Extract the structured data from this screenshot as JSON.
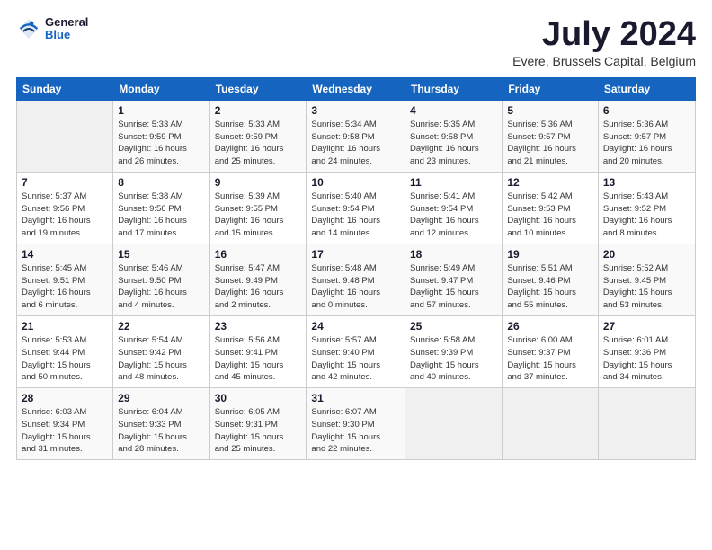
{
  "logo": {
    "general": "General",
    "blue": "Blue"
  },
  "header": {
    "month": "July 2024",
    "location": "Evere, Brussels Capital, Belgium"
  },
  "weekdays": [
    "Sunday",
    "Monday",
    "Tuesday",
    "Wednesday",
    "Thursday",
    "Friday",
    "Saturday"
  ],
  "weeks": [
    [
      {
        "day": "",
        "info": ""
      },
      {
        "day": "1",
        "info": "Sunrise: 5:33 AM\nSunset: 9:59 PM\nDaylight: 16 hours\nand 26 minutes."
      },
      {
        "day": "2",
        "info": "Sunrise: 5:33 AM\nSunset: 9:59 PM\nDaylight: 16 hours\nand 25 minutes."
      },
      {
        "day": "3",
        "info": "Sunrise: 5:34 AM\nSunset: 9:58 PM\nDaylight: 16 hours\nand 24 minutes."
      },
      {
        "day": "4",
        "info": "Sunrise: 5:35 AM\nSunset: 9:58 PM\nDaylight: 16 hours\nand 23 minutes."
      },
      {
        "day": "5",
        "info": "Sunrise: 5:36 AM\nSunset: 9:57 PM\nDaylight: 16 hours\nand 21 minutes."
      },
      {
        "day": "6",
        "info": "Sunrise: 5:36 AM\nSunset: 9:57 PM\nDaylight: 16 hours\nand 20 minutes."
      }
    ],
    [
      {
        "day": "7",
        "info": "Sunrise: 5:37 AM\nSunset: 9:56 PM\nDaylight: 16 hours\nand 19 minutes."
      },
      {
        "day": "8",
        "info": "Sunrise: 5:38 AM\nSunset: 9:56 PM\nDaylight: 16 hours\nand 17 minutes."
      },
      {
        "day": "9",
        "info": "Sunrise: 5:39 AM\nSunset: 9:55 PM\nDaylight: 16 hours\nand 15 minutes."
      },
      {
        "day": "10",
        "info": "Sunrise: 5:40 AM\nSunset: 9:54 PM\nDaylight: 16 hours\nand 14 minutes."
      },
      {
        "day": "11",
        "info": "Sunrise: 5:41 AM\nSunset: 9:54 PM\nDaylight: 16 hours\nand 12 minutes."
      },
      {
        "day": "12",
        "info": "Sunrise: 5:42 AM\nSunset: 9:53 PM\nDaylight: 16 hours\nand 10 minutes."
      },
      {
        "day": "13",
        "info": "Sunrise: 5:43 AM\nSunset: 9:52 PM\nDaylight: 16 hours\nand 8 minutes."
      }
    ],
    [
      {
        "day": "14",
        "info": "Sunrise: 5:45 AM\nSunset: 9:51 PM\nDaylight: 16 hours\nand 6 minutes."
      },
      {
        "day": "15",
        "info": "Sunrise: 5:46 AM\nSunset: 9:50 PM\nDaylight: 16 hours\nand 4 minutes."
      },
      {
        "day": "16",
        "info": "Sunrise: 5:47 AM\nSunset: 9:49 PM\nDaylight: 16 hours\nand 2 minutes."
      },
      {
        "day": "17",
        "info": "Sunrise: 5:48 AM\nSunset: 9:48 PM\nDaylight: 16 hours\nand 0 minutes."
      },
      {
        "day": "18",
        "info": "Sunrise: 5:49 AM\nSunset: 9:47 PM\nDaylight: 15 hours\nand 57 minutes."
      },
      {
        "day": "19",
        "info": "Sunrise: 5:51 AM\nSunset: 9:46 PM\nDaylight: 15 hours\nand 55 minutes."
      },
      {
        "day": "20",
        "info": "Sunrise: 5:52 AM\nSunset: 9:45 PM\nDaylight: 15 hours\nand 53 minutes."
      }
    ],
    [
      {
        "day": "21",
        "info": "Sunrise: 5:53 AM\nSunset: 9:44 PM\nDaylight: 15 hours\nand 50 minutes."
      },
      {
        "day": "22",
        "info": "Sunrise: 5:54 AM\nSunset: 9:42 PM\nDaylight: 15 hours\nand 48 minutes."
      },
      {
        "day": "23",
        "info": "Sunrise: 5:56 AM\nSunset: 9:41 PM\nDaylight: 15 hours\nand 45 minutes."
      },
      {
        "day": "24",
        "info": "Sunrise: 5:57 AM\nSunset: 9:40 PM\nDaylight: 15 hours\nand 42 minutes."
      },
      {
        "day": "25",
        "info": "Sunrise: 5:58 AM\nSunset: 9:39 PM\nDaylight: 15 hours\nand 40 minutes."
      },
      {
        "day": "26",
        "info": "Sunrise: 6:00 AM\nSunset: 9:37 PM\nDaylight: 15 hours\nand 37 minutes."
      },
      {
        "day": "27",
        "info": "Sunrise: 6:01 AM\nSunset: 9:36 PM\nDaylight: 15 hours\nand 34 minutes."
      }
    ],
    [
      {
        "day": "28",
        "info": "Sunrise: 6:03 AM\nSunset: 9:34 PM\nDaylight: 15 hours\nand 31 minutes."
      },
      {
        "day": "29",
        "info": "Sunrise: 6:04 AM\nSunset: 9:33 PM\nDaylight: 15 hours\nand 28 minutes."
      },
      {
        "day": "30",
        "info": "Sunrise: 6:05 AM\nSunset: 9:31 PM\nDaylight: 15 hours\nand 25 minutes."
      },
      {
        "day": "31",
        "info": "Sunrise: 6:07 AM\nSunset: 9:30 PM\nDaylight: 15 hours\nand 22 minutes."
      },
      {
        "day": "",
        "info": ""
      },
      {
        "day": "",
        "info": ""
      },
      {
        "day": "",
        "info": ""
      }
    ]
  ]
}
